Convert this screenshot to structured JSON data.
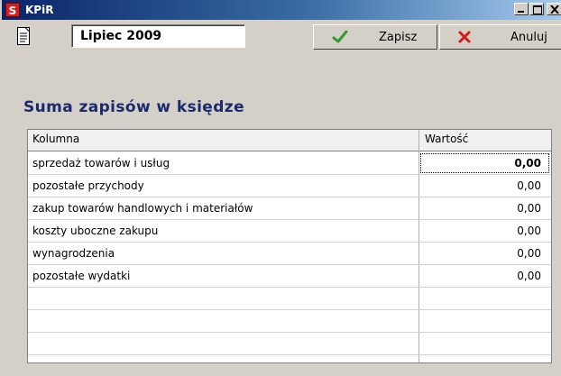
{
  "window": {
    "app_icon_letter": "S",
    "title": "KPiR",
    "controls": [
      "minimize",
      "maximize",
      "close"
    ]
  },
  "toolbar": {
    "doc_icon": "document-icon",
    "period": "Lipiec 2009",
    "save_label": "Zapisz",
    "save_icon": "checkmark-icon",
    "cancel_label": "Anuluj",
    "cancel_icon": "x-icon"
  },
  "heading": "Suma zapisów w księdze",
  "grid": {
    "columns": [
      "Kolumna",
      "Wartość"
    ],
    "rows": [
      {
        "name": "sprzedaż towarów i usług",
        "value": "0,00"
      },
      {
        "name": "pozostałe przychody",
        "value": "0,00"
      },
      {
        "name": "zakup towarów handlowych i materiałów",
        "value": "0,00"
      },
      {
        "name": "koszty uboczne zakupu",
        "value": "0,00"
      },
      {
        "name": "wynagrodzenia",
        "value": "0,00"
      },
      {
        "name": "pozostałe wydatki",
        "value": "0,00"
      },
      {
        "name": "",
        "value": ""
      },
      {
        "name": "",
        "value": ""
      },
      {
        "name": "",
        "value": ""
      }
    ]
  },
  "colors": {
    "title_gradient_start": "#0a246a",
    "heading": "#1a2a6c",
    "save_check": "#2e9a2e",
    "cancel_x": "#d41818"
  }
}
